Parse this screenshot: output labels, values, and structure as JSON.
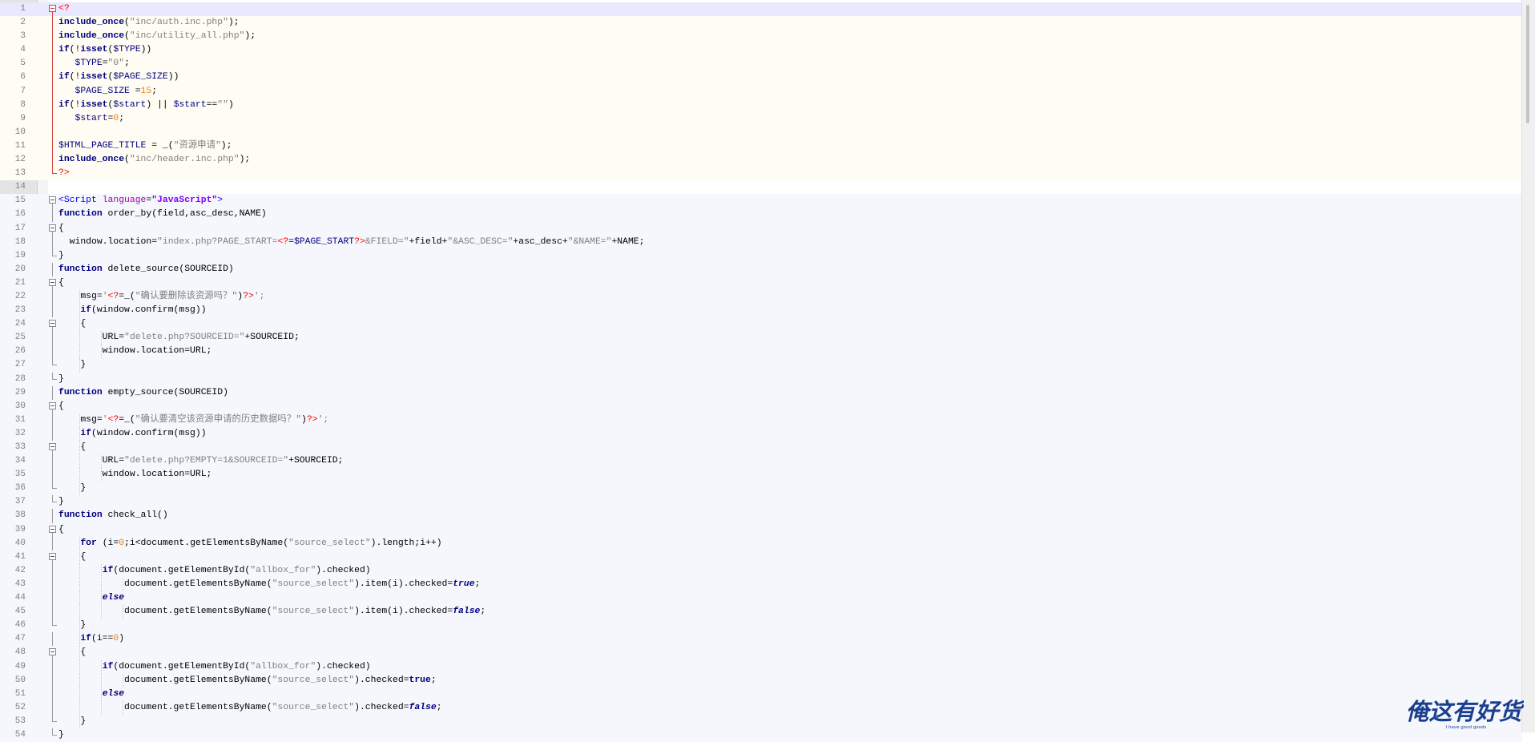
{
  "editor": {
    "lines": [
      {
        "n": "1",
        "bg": "sel",
        "fold": "box-red",
        "indent": 0,
        "t": [
          [
            "<?",
            "phptag"
          ]
        ]
      },
      {
        "n": "2",
        "bg": "php",
        "fold": "line-red",
        "indent": 0,
        "t": [
          [
            "include_once",
            "kw"
          ],
          [
            "(",
            ""
          ],
          [
            "\"inc/auth.inc.php\"",
            "str"
          ],
          [
            ");",
            ""
          ]
        ]
      },
      {
        "n": "3",
        "bg": "php",
        "fold": "line-red",
        "indent": 0,
        "t": [
          [
            "include_once",
            "kw"
          ],
          [
            "(",
            ""
          ],
          [
            "\"inc/utility_all.php\"",
            "str"
          ],
          [
            ");",
            ""
          ]
        ]
      },
      {
        "n": "4",
        "bg": "php",
        "fold": "line-red",
        "indent": 0,
        "t": [
          [
            "if",
            "kw"
          ],
          [
            "(!",
            ""
          ],
          [
            "isset",
            "kw"
          ],
          [
            "(",
            ""
          ],
          [
            "$TYPE",
            "var"
          ],
          [
            "))",
            ""
          ]
        ]
      },
      {
        "n": "5",
        "bg": "php",
        "fold": "line-red",
        "indent": 0,
        "t": [
          [
            "   ",
            ""
          ],
          [
            "$TYPE",
            "var"
          ],
          [
            "=",
            ""
          ],
          [
            "\"0\"",
            "str"
          ],
          [
            ";",
            ""
          ]
        ]
      },
      {
        "n": "6",
        "bg": "php",
        "fold": "line-red",
        "indent": 0,
        "t": [
          [
            "if",
            "kw"
          ],
          [
            "(!",
            ""
          ],
          [
            "isset",
            "kw"
          ],
          [
            "(",
            ""
          ],
          [
            "$PAGE_SIZE",
            "var"
          ],
          [
            "))",
            ""
          ]
        ]
      },
      {
        "n": "7",
        "bg": "php",
        "fold": "line-red",
        "indent": 0,
        "t": [
          [
            "   ",
            ""
          ],
          [
            "$PAGE_SIZE",
            "var"
          ],
          [
            " =",
            ""
          ],
          [
            "15",
            "num"
          ],
          [
            ";",
            ""
          ]
        ]
      },
      {
        "n": "8",
        "bg": "php",
        "fold": "line-red",
        "indent": 0,
        "t": [
          [
            "if",
            "kw"
          ],
          [
            "(!",
            ""
          ],
          [
            "isset",
            "kw"
          ],
          [
            "(",
            ""
          ],
          [
            "$start",
            "var"
          ],
          [
            ") || ",
            ""
          ],
          [
            "$start",
            "var"
          ],
          [
            "==",
            ""
          ],
          [
            "\"\"",
            "str"
          ],
          [
            ")",
            ""
          ]
        ]
      },
      {
        "n": "9",
        "bg": "php",
        "fold": "line-red",
        "indent": 0,
        "t": [
          [
            "   ",
            ""
          ],
          [
            "$start",
            "var"
          ],
          [
            "=",
            ""
          ],
          [
            "0",
            "num"
          ],
          [
            ";",
            ""
          ]
        ]
      },
      {
        "n": "10",
        "bg": "php",
        "fold": "line-red",
        "indent": 0,
        "t": []
      },
      {
        "n": "11",
        "bg": "php",
        "fold": "line-red",
        "indent": 0,
        "t": [
          [
            "$HTML_PAGE_TITLE",
            "var"
          ],
          [
            " = _(",
            ""
          ],
          [
            "\"资源申请\"",
            "str"
          ],
          [
            ");",
            ""
          ]
        ]
      },
      {
        "n": "12",
        "bg": "php",
        "fold": "line-red",
        "indent": 0,
        "t": [
          [
            "include_once",
            "kw"
          ],
          [
            "(",
            ""
          ],
          [
            "\"inc/header.inc.php\"",
            "str"
          ],
          [
            ");",
            ""
          ]
        ]
      },
      {
        "n": "13",
        "bg": "php",
        "fold": "end-red",
        "indent": 0,
        "t": [
          [
            "?>",
            "phptag"
          ]
        ]
      },
      {
        "n": "14",
        "bg": "",
        "fold": "",
        "indent": 0,
        "t": []
      },
      {
        "n": "15",
        "bg": "js",
        "fold": "box",
        "indent": 0,
        "t": [
          [
            "<Script ",
            "tag"
          ],
          [
            "language",
            "attr"
          ],
          [
            "=",
            ""
          ],
          [
            "\"JavaScript\"",
            "attrv"
          ],
          [
            ">",
            "tag"
          ]
        ]
      },
      {
        "n": "16",
        "bg": "js",
        "fold": "line",
        "indent": 0,
        "t": [
          [
            "function",
            "kw"
          ],
          [
            " order_by(field,asc_desc,NAME)",
            ""
          ]
        ]
      },
      {
        "n": "17",
        "bg": "js",
        "fold": "box",
        "indent": 0,
        "t": [
          [
            "{",
            ""
          ]
        ]
      },
      {
        "n": "18",
        "bg": "js",
        "fold": "line",
        "indent": 0,
        "t": [
          [
            "  window.location=",
            ""
          ],
          [
            "\"index.php?PAGE_START=",
            "str"
          ],
          [
            "<?",
            "phptag"
          ],
          [
            "=",
            ""
          ],
          [
            "$PAGE_START",
            "var"
          ],
          [
            "?>",
            "phptag"
          ],
          [
            "&FIELD=\"",
            "str"
          ],
          [
            "+field+",
            ""
          ],
          [
            "\"&ASC_DESC=\"",
            "str"
          ],
          [
            "+asc_desc+",
            ""
          ],
          [
            "\"&NAME=\"",
            "str"
          ],
          [
            "+NAME;",
            ""
          ]
        ]
      },
      {
        "n": "19",
        "bg": "js",
        "fold": "end",
        "indent": 0,
        "t": [
          [
            "}",
            ""
          ]
        ]
      },
      {
        "n": "20",
        "bg": "js",
        "fold": "line",
        "indent": 0,
        "t": [
          [
            "function",
            "kw"
          ],
          [
            " delete_source(SOURCEID)",
            ""
          ]
        ]
      },
      {
        "n": "21",
        "bg": "js",
        "fold": "box",
        "indent": 0,
        "t": [
          [
            "{",
            ""
          ]
        ]
      },
      {
        "n": "22",
        "bg": "js",
        "fold": "line",
        "indent": 1,
        "t": [
          [
            "    msg=",
            ""
          ],
          [
            "'",
            "str"
          ],
          [
            "<?",
            "phptag"
          ],
          [
            "=_(",
            ""
          ],
          [
            "\"确认要删除该资源吗？\"",
            "str"
          ],
          [
            ")",
            ""
          ],
          [
            "?>",
            "phptag"
          ],
          [
            "';",
            "str"
          ]
        ]
      },
      {
        "n": "23",
        "bg": "js",
        "fold": "line",
        "indent": 1,
        "t": [
          [
            "    ",
            ""
          ],
          [
            "if",
            "kw"
          ],
          [
            "(window.confirm(msg))",
            ""
          ]
        ]
      },
      {
        "n": "24",
        "bg": "js",
        "fold": "box",
        "indent": 1,
        "t": [
          [
            "    {",
            ""
          ]
        ]
      },
      {
        "n": "25",
        "bg": "js",
        "fold": "line",
        "indent": 2,
        "t": [
          [
            "        URL=",
            ""
          ],
          [
            "\"delete.php?SOURCEID=\"",
            "str"
          ],
          [
            "+SOURCEID;",
            ""
          ]
        ]
      },
      {
        "n": "26",
        "bg": "js",
        "fold": "line",
        "indent": 2,
        "t": [
          [
            "        window.location=URL;",
            ""
          ]
        ]
      },
      {
        "n": "27",
        "bg": "js",
        "fold": "end",
        "indent": 1,
        "t": [
          [
            "    }",
            ""
          ]
        ]
      },
      {
        "n": "28",
        "bg": "js",
        "fold": "end",
        "indent": 0,
        "t": [
          [
            "}",
            ""
          ]
        ]
      },
      {
        "n": "29",
        "bg": "js",
        "fold": "line",
        "indent": 0,
        "t": [
          [
            "function",
            "kw"
          ],
          [
            " empty_source(SOURCEID)",
            ""
          ]
        ]
      },
      {
        "n": "30",
        "bg": "js",
        "fold": "box",
        "indent": 0,
        "t": [
          [
            "{",
            ""
          ]
        ]
      },
      {
        "n": "31",
        "bg": "js",
        "fold": "line",
        "indent": 1,
        "t": [
          [
            "    msg=",
            ""
          ],
          [
            "'",
            "str"
          ],
          [
            "<?",
            "phptag"
          ],
          [
            "=_(",
            ""
          ],
          [
            "\"确认要清空该资源申请的历史数据吗？\"",
            "str"
          ],
          [
            ")",
            ""
          ],
          [
            "?>",
            "phptag"
          ],
          [
            "';",
            "str"
          ]
        ]
      },
      {
        "n": "32",
        "bg": "js",
        "fold": "line",
        "indent": 1,
        "t": [
          [
            "    ",
            ""
          ],
          [
            "if",
            "kw"
          ],
          [
            "(window.confirm(msg))",
            ""
          ]
        ]
      },
      {
        "n": "33",
        "bg": "js",
        "fold": "box",
        "indent": 1,
        "t": [
          [
            "    {",
            ""
          ]
        ]
      },
      {
        "n": "34",
        "bg": "js",
        "fold": "line",
        "indent": 2,
        "t": [
          [
            "        URL=",
            ""
          ],
          [
            "\"delete.php?EMPTY=1&SOURCEID=\"",
            "str"
          ],
          [
            "+SOURCEID;",
            ""
          ]
        ]
      },
      {
        "n": "35",
        "bg": "js",
        "fold": "line",
        "indent": 2,
        "t": [
          [
            "        window.location=URL;",
            ""
          ]
        ]
      },
      {
        "n": "36",
        "bg": "js",
        "fold": "end",
        "indent": 1,
        "t": [
          [
            "    }",
            ""
          ]
        ]
      },
      {
        "n": "37",
        "bg": "js",
        "fold": "end",
        "indent": 0,
        "t": [
          [
            "}",
            ""
          ]
        ]
      },
      {
        "n": "38",
        "bg": "js",
        "fold": "line",
        "indent": 0,
        "t": [
          [
            "function",
            "kw"
          ],
          [
            " check_all()",
            ""
          ]
        ]
      },
      {
        "n": "39",
        "bg": "js",
        "fold": "box",
        "indent": 0,
        "t": [
          [
            "{",
            ""
          ]
        ]
      },
      {
        "n": "40",
        "bg": "js",
        "fold": "line",
        "indent": 1,
        "t": [
          [
            "    ",
            ""
          ],
          [
            "for",
            "kw"
          ],
          [
            " (i=",
            ""
          ],
          [
            "0",
            "num"
          ],
          [
            ";i<document.getElementsByName(",
            ""
          ],
          [
            "\"source_select\"",
            "str"
          ],
          [
            ").length;i++)",
            ""
          ]
        ]
      },
      {
        "n": "41",
        "bg": "js",
        "fold": "box",
        "indent": 1,
        "t": [
          [
            "    {",
            ""
          ]
        ]
      },
      {
        "n": "42",
        "bg": "js",
        "fold": "line",
        "indent": 2,
        "t": [
          [
            "        ",
            ""
          ],
          [
            "if",
            "kw"
          ],
          [
            "(document.getElementById(",
            ""
          ],
          [
            "\"allbox_for\"",
            "str"
          ],
          [
            ").checked)",
            ""
          ]
        ]
      },
      {
        "n": "43",
        "bg": "js",
        "fold": "line",
        "indent": 3,
        "t": [
          [
            "            document.getElementsByName(",
            ""
          ],
          [
            "\"source_select\"",
            "str"
          ],
          [
            ").item(i).checked=",
            ""
          ],
          [
            "true",
            "kw it"
          ],
          [
            ";",
            ""
          ]
        ]
      },
      {
        "n": "44",
        "bg": "js",
        "fold": "line",
        "indent": 2,
        "t": [
          [
            "        ",
            ""
          ],
          [
            "else",
            "kw it"
          ]
        ]
      },
      {
        "n": "45",
        "bg": "js",
        "fold": "line",
        "indent": 3,
        "t": [
          [
            "            document.getElementsByName(",
            ""
          ],
          [
            "\"source_select\"",
            "str"
          ],
          [
            ").item(i).checked=",
            ""
          ],
          [
            "false",
            "kw it"
          ],
          [
            ";",
            ""
          ]
        ]
      },
      {
        "n": "46",
        "bg": "js",
        "fold": "end",
        "indent": 1,
        "t": [
          [
            "    }",
            ""
          ]
        ]
      },
      {
        "n": "47",
        "bg": "js",
        "fold": "line",
        "indent": 1,
        "t": [
          [
            "    ",
            ""
          ],
          [
            "if",
            "kw"
          ],
          [
            "(i==",
            ""
          ],
          [
            "0",
            "num"
          ],
          [
            ")",
            ""
          ]
        ]
      },
      {
        "n": "48",
        "bg": "js",
        "fold": "box",
        "indent": 1,
        "t": [
          [
            "    {",
            ""
          ]
        ]
      },
      {
        "n": "49",
        "bg": "js",
        "fold": "line",
        "indent": 2,
        "t": [
          [
            "        ",
            ""
          ],
          [
            "if",
            "kw"
          ],
          [
            "(document.getElementById(",
            ""
          ],
          [
            "\"allbox_for\"",
            "str"
          ],
          [
            ").checked)",
            ""
          ]
        ]
      },
      {
        "n": "50",
        "bg": "js",
        "fold": "line",
        "indent": 3,
        "t": [
          [
            "            document.getElementsByName(",
            ""
          ],
          [
            "\"source_select\"",
            "str"
          ],
          [
            ").checked=",
            ""
          ],
          [
            "true",
            "kw"
          ],
          [
            ";",
            ""
          ]
        ]
      },
      {
        "n": "51",
        "bg": "js",
        "fold": "line",
        "indent": 2,
        "t": [
          [
            "        ",
            ""
          ],
          [
            "else",
            "kw it"
          ]
        ]
      },
      {
        "n": "52",
        "bg": "js",
        "fold": "line",
        "indent": 3,
        "t": [
          [
            "            document.getElementsByName(",
            ""
          ],
          [
            "\"source_select\"",
            "str"
          ],
          [
            ").checked=",
            ""
          ],
          [
            "false",
            "kw it"
          ],
          [
            ";",
            ""
          ]
        ]
      },
      {
        "n": "53",
        "bg": "js",
        "fold": "end",
        "indent": 1,
        "t": [
          [
            "    }",
            ""
          ]
        ]
      },
      {
        "n": "54",
        "bg": "js",
        "fold": "end",
        "indent": 0,
        "t": [
          [
            "}",
            ""
          ]
        ]
      }
    ]
  },
  "watermark": {
    "text": "俺这有好货",
    "subtext": "I have good goods",
    "color": "#1b3f8f"
  }
}
